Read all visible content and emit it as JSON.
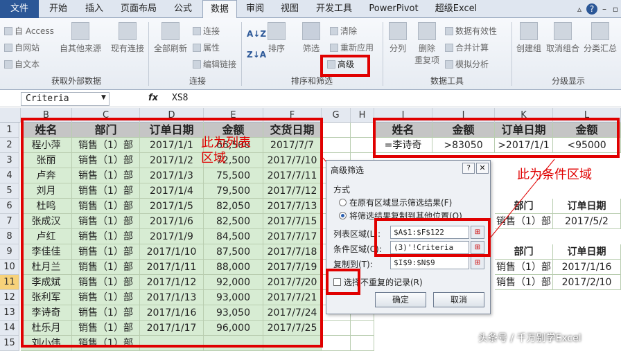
{
  "tabs": [
    "文件",
    "开始",
    "插入",
    "页面布局",
    "公式",
    "数据",
    "审阅",
    "视图",
    "开发工具",
    "PowerPivot",
    "超级Excel"
  ],
  "ribbon": {
    "ext_items": [
      "自 Access",
      "自网站",
      "自文本"
    ],
    "other_src": "自其他来源",
    "existing": "现有连接",
    "group_ext": "获取外部数据",
    "refresh_all": "全部刷新",
    "conn_items": [
      "连接",
      "属性",
      "编辑链接"
    ],
    "group_conn": "连接",
    "sort": "排序",
    "filter": "筛选",
    "sf_items": [
      "清除",
      "重新应用"
    ],
    "advanced": "高级",
    "group_sf": "排序和筛选",
    "split": "分列",
    "remove_dup": "删除\n重复项",
    "dt_items": [
      "数据有效性",
      "合并计算",
      "模拟分析"
    ],
    "group_dt": "数据工具",
    "group_create": "创建组",
    "ungroup": "取消组合",
    "subtotal": "分类汇总",
    "group_outline": "分级显示"
  },
  "formula_bar": {
    "name_box": "Criteria",
    "fx": "fx",
    "value": "XS8"
  },
  "columns": [
    "B",
    "C",
    "D",
    "E",
    "F",
    "G",
    "H",
    "I",
    "J",
    "K",
    "L"
  ],
  "rows": [
    "1",
    "2",
    "3",
    "4",
    "5",
    "6",
    "7",
    "8",
    "9",
    "10",
    "11",
    "12",
    "13",
    "14",
    "15"
  ],
  "list": {
    "headers": [
      "姓名",
      "部门",
      "订单日期",
      "金额",
      "交货日期"
    ],
    "rows": [
      [
        "程小萍",
        "销售（1）部",
        "2017/1/1",
        "66,500",
        "2017/7/7"
      ],
      [
        "张丽",
        "销售（1）部",
        "2017/1/2",
        "72,500",
        "2017/7/10"
      ],
      [
        "卢奔",
        "销售（1）部",
        "2017/1/3",
        "75,500",
        "2017/7/11"
      ],
      [
        "刘月",
        "销售（1）部",
        "2017/1/4",
        "79,500",
        "2017/7/12"
      ],
      [
        "杜鸣",
        "销售（1）部",
        "2017/1/5",
        "82,050",
        "2017/7/13"
      ],
      [
        "张成汉",
        "销售（1）部",
        "2017/1/6",
        "82,500",
        "2017/7/15"
      ],
      [
        "卢红",
        "销售（1）部",
        "2017/1/9",
        "84,500",
        "2017/7/17"
      ],
      [
        "李佳佳",
        "销售（1）部",
        "2017/1/10",
        "87,500",
        "2017/7/18"
      ],
      [
        "杜月兰",
        "销售（1）部",
        "2017/1/11",
        "88,000",
        "2017/7/19"
      ],
      [
        "李成斌",
        "销售（1）部",
        "2017/1/12",
        "92,000",
        "2017/7/20"
      ],
      [
        "张利军",
        "销售（1）部",
        "2017/1/13",
        "93,000",
        "2017/7/21"
      ],
      [
        "李诗奇",
        "销售（1）部",
        "2017/1/16",
        "93,050",
        "2017/7/24"
      ],
      [
        "杜乐月",
        "销售（1）部",
        "2017/1/17",
        "96,000",
        "2017/7/25"
      ],
      [
        "刘小伟",
        "销售（1）部",
        "",
        "",
        ""
      ]
    ]
  },
  "criteria": {
    "headers": [
      "姓名",
      "金额",
      "订单日期",
      "金额"
    ],
    "values": [
      "=李诗奇",
      ">83050",
      ">2017/1/1",
      "<95000"
    ]
  },
  "right_partial": {
    "hdr1": [
      "部门",
      "订单日期"
    ],
    "row7": [
      "销售（1）部",
      "2017/5/2"
    ],
    "hdr2": [
      "部门",
      "订单日期"
    ],
    "row10": [
      "销售（1）部",
      "2017/1/16"
    ],
    "row11": [
      "销售（1）部",
      "2017/2/10"
    ]
  },
  "annotations": {
    "list_area": "此为列表\n区域",
    "criteria_area": "此为条件区域"
  },
  "dialog": {
    "title": "高级筛选",
    "help": "?",
    "close": "✕",
    "method": "方式",
    "opt1": "在原有区域显示筛选结果(F)",
    "opt2": "将筛选结果复制到其他位置(O)",
    "list_label": "列表区域(L):",
    "list_value": "$A$1:$F$122",
    "crit_label": "条件区域(C):",
    "crit_value": "(3)'!Criteria",
    "copy_label": "复制到(T):",
    "copy_value": "$I$9:$N$9",
    "unique": "选择不重复的记录(R)",
    "ok": "确定",
    "cancel": "取消"
  },
  "watermark": "头条号 / 千万别学Excel",
  "colors": {
    "accent": "#e00000",
    "file_tab": "#2b5797",
    "cell_green": "#d7ecd3",
    "header_gray": "#c5c5c5"
  }
}
